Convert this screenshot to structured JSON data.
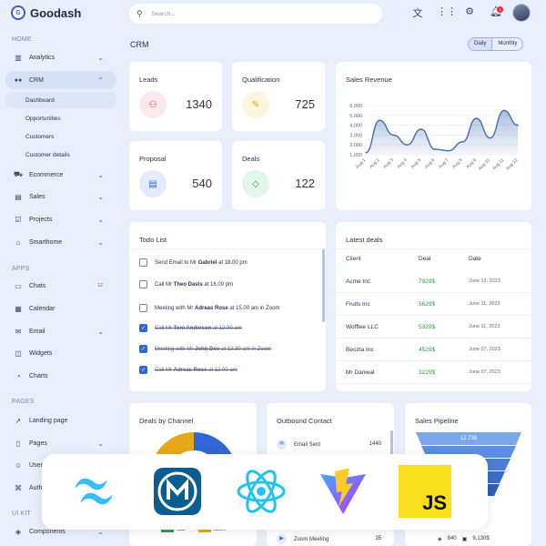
{
  "brand": {
    "logo_letter": "G",
    "name": "Goodash"
  },
  "sidebar": {
    "sections": {
      "home": "HOME",
      "apps": "APPS",
      "pages": "PAGES",
      "ui_kit": "UI KIT"
    },
    "items": [
      {
        "label": "Analytics",
        "icon": "chart-icon",
        "glyph": "▥"
      },
      {
        "label": "CRM",
        "icon": "users-icon",
        "glyph": "👥"
      },
      {
        "label": "Ecommerce",
        "icon": "cart-icon",
        "glyph": "🛒"
      },
      {
        "label": "Sales",
        "icon": "sales-icon",
        "glyph": "▤"
      },
      {
        "label": "Projects",
        "icon": "projects-icon",
        "glyph": "☑"
      },
      {
        "label": "Smarthome",
        "icon": "home-icon",
        "glyph": "⌂"
      },
      {
        "label": "Chats",
        "icon": "chat-icon",
        "glyph": "▭",
        "badge": "12"
      },
      {
        "label": "Calendar",
        "icon": "calendar-icon",
        "glyph": "▦"
      },
      {
        "label": "Email",
        "icon": "mail-icon",
        "glyph": "✉"
      },
      {
        "label": "Widgets",
        "icon": "widgets-icon",
        "glyph": "◫"
      },
      {
        "label": "Charts",
        "icon": "pie-icon",
        "glyph": "◔"
      },
      {
        "label": "Landing page",
        "icon": "rocket-icon",
        "glyph": "➚"
      },
      {
        "label": "Pages",
        "icon": "file-icon",
        "glyph": "▯"
      },
      {
        "label": "Users",
        "icon": "user-icon",
        "glyph": "☺"
      },
      {
        "label": "Auth",
        "icon": "lock-icon",
        "glyph": "⌘"
      },
      {
        "label": "Components",
        "icon": "components-icon",
        "glyph": "◈"
      }
    ],
    "crm_sub": [
      "Dashboard",
      "Opportunities",
      "Customers",
      "Customer details"
    ]
  },
  "header": {
    "search_placeholder": "Search..."
  },
  "page": {
    "title": "CRM",
    "toggle": [
      "Daily",
      "Monthly"
    ]
  },
  "kpis": {
    "leads": {
      "label": "Leads",
      "value": "1340"
    },
    "qualification": {
      "label": "Qualification",
      "value": "725"
    },
    "proposal": {
      "label": "Proposal",
      "value": "540"
    },
    "deals": {
      "label": "Deals",
      "value": "122"
    }
  },
  "colors": {
    "accent": "#2f67d6",
    "line": "#3f6fb3",
    "green": "#2f9e44",
    "pink_bg": "#fde8ec",
    "yellow_bg": "#fdf6dc",
    "blue_bg": "#e4ecfb",
    "green_bg": "#e3f6ec"
  },
  "chart_data": {
    "type": "area",
    "title": "Sales Revenue",
    "categories": [
      "Aug 1",
      "Aug 2",
      "Aug 3",
      "Aug 4",
      "Aug 5",
      "Aug 6",
      "Aug 7",
      "Aug 8",
      "Aug 9",
      "Aug 10",
      "Aug 11",
      "Aug 12"
    ],
    "values": [
      1200,
      4500,
      3000,
      2000,
      3600,
      1550,
      1400,
      2300,
      4700,
      2700,
      5500,
      4000
    ],
    "ylim": [
      1000,
      6000
    ],
    "yticks": [
      "1,000",
      "2,000",
      "3,000",
      "4,000",
      "5,000",
      "6,000"
    ],
    "grid": true
  },
  "todo": {
    "title": "Todo List",
    "items": [
      {
        "pre": "Send Email to Mr ",
        "bold": "Gabriel",
        "post": " at 18.00 pm",
        "done": false
      },
      {
        "pre": "Call Mr ",
        "bold": "Theo Davis",
        "post": " at 16.00 pm",
        "done": false
      },
      {
        "pre": "Meeting with Mr ",
        "bold": "Adreas Rose",
        "post": " at 15.00 am in Zoom",
        "done": false
      },
      {
        "pre": "Call Mr ",
        "bold": "Toni Anderson",
        "post": " at 12.00 am",
        "done": true
      },
      {
        "pre": "Meeting with Mr ",
        "bold": "John Doe",
        "post": " at 12.30 am in Zoom",
        "done": true
      },
      {
        "pre": "Call Mr ",
        "bold": "Adreas Rose",
        "post": " at 12.00 am",
        "done": true
      }
    ]
  },
  "deals": {
    "title": "Latest deals",
    "headers": [
      "Client",
      "Deal",
      "Date"
    ],
    "rows": [
      [
        "Acme Inc",
        "7929$",
        "June 12, 2023"
      ],
      [
        "Fruits Inc",
        "5629$",
        "June 11, 2023"
      ],
      [
        "Wofftee LLC",
        "5329$",
        "June 11, 2023"
      ],
      [
        "Beozta Inc",
        "4529$",
        "June 07, 2023"
      ],
      [
        "Mr Danieal",
        "3229$",
        "June 07, 2023"
      ]
    ]
  },
  "channel": {
    "title": "Deals by Channel",
    "legend": [
      "Call",
      "Store"
    ]
  },
  "outbound": {
    "title": "Outbound Contact",
    "rows": [
      {
        "label": "Email Sent",
        "value": "1440"
      },
      {
        "label": "Zoom Meeting",
        "value": "35"
      }
    ]
  },
  "pipeline": {
    "title": "Sales Pipeline",
    "top_value": "12.738",
    "stats": [
      "840",
      "9,130$"
    ]
  },
  "overlay": [
    "tailwind-icon",
    "mui-icon",
    "react-icon",
    "vite-icon",
    "javascript-icon"
  ],
  "overlay_text": {
    "js": "JS"
  }
}
